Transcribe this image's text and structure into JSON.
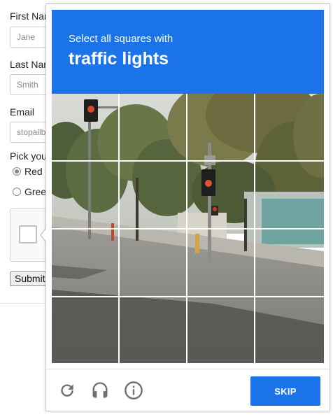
{
  "form": {
    "first_name_label": "First Nar",
    "first_name_placeholder": "Jane",
    "last_name_label": "Last Nar",
    "last_name_placeholder": "Smith",
    "email_label": "Email",
    "email_placeholder": "stopallb",
    "pick_label": "Pick you",
    "radio_options": [
      {
        "label": "Red",
        "selected": true
      },
      {
        "label": "Gree",
        "selected": false
      }
    ],
    "submit_label": "Submit"
  },
  "challenge": {
    "instruction": "Select all squares with",
    "target": "traffic lights",
    "accent_color": "#1a73e8",
    "grid_rows": 4,
    "grid_cols": 4,
    "footer_icons": [
      "reload-icon",
      "audio-icon",
      "info-icon"
    ],
    "skip_label": "SKIP"
  }
}
